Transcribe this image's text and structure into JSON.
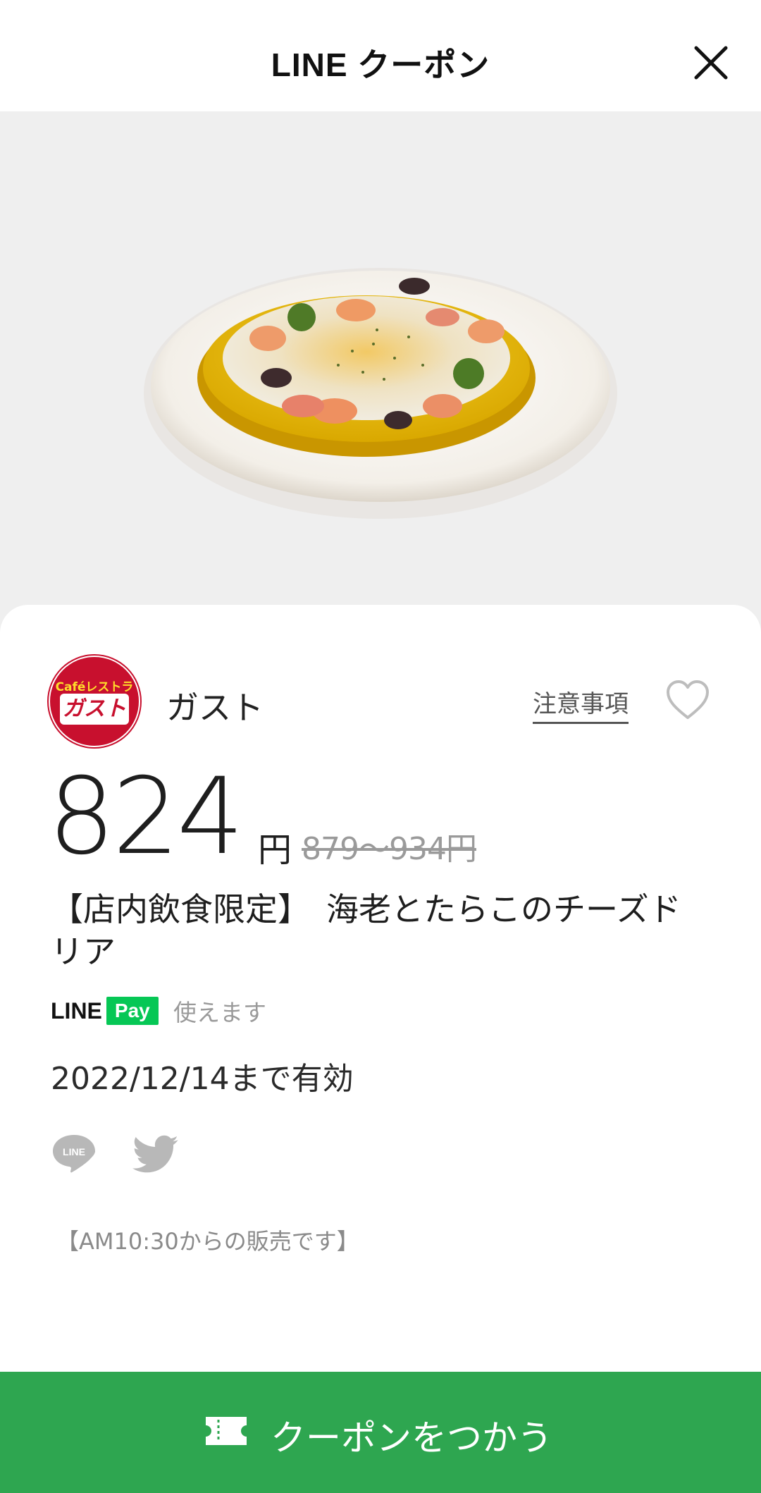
{
  "header": {
    "title": "LINE クーポン",
    "close_icon": "close-icon"
  },
  "hero": {
    "image_description_icon": "food-photo"
  },
  "coupon": {
    "brand_logo_text_top": "Caféレストラン",
    "brand_logo_text_main": "ガスト",
    "brand_name": "ガスト",
    "notice_label": "注意事項",
    "favorite_icon": "heart-icon",
    "price": "824",
    "price_unit": "円",
    "original_price": "879〜934円",
    "title": "【店内飲食限定】　海老とたらこのチーズドリア",
    "linepay_line": "LINE",
    "linepay_pay": "Pay",
    "linepay_usable": "使えます",
    "validity": "2022/12/14まで有効",
    "share_line_icon": "line-share-icon",
    "share_twitter_icon": "twitter-icon",
    "share_line_text": "LINE",
    "note": "【AM10:30からの販売です】"
  },
  "footer": {
    "use_button_label": "クーポンをつかう",
    "ticket_icon": "ticket-icon"
  },
  "colors": {
    "accent_green": "#2ea650",
    "brand_red": "#c8102e",
    "linepay_green": "#06c755"
  }
}
